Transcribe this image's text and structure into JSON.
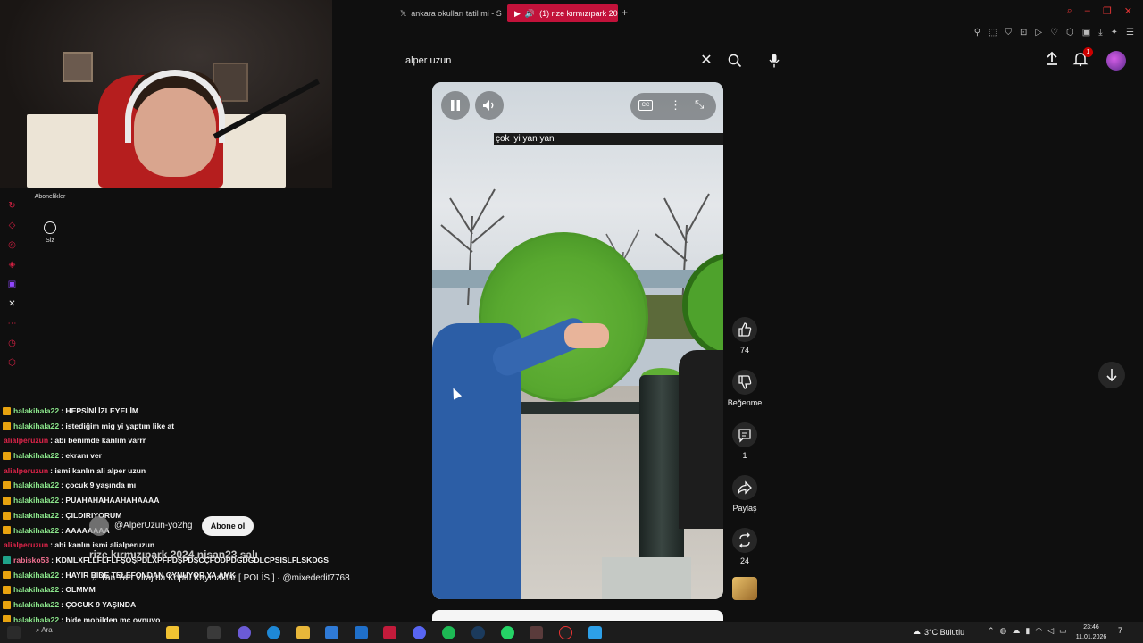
{
  "browser": {
    "tabs": [
      {
        "label": "ankara okulları tatil mi - Se",
        "favicon": "x-icon"
      },
      {
        "label": "(1) rize kırmızıpark 202",
        "favicon": "youtube-icon"
      }
    ],
    "new_tab": "+"
  },
  "youtube": {
    "search": {
      "value": "alper uzun"
    },
    "notifications_count": "1",
    "sidebar": {
      "subscriptions_label": "Abonelikler",
      "you_label": "Siz"
    },
    "short": {
      "caption": "çok iyi yan yan",
      "likes": "74",
      "dislike_label": "Beğenme",
      "comments": "1",
      "share_label": "Paylaş",
      "remix": "24",
      "channel_handle": "@AlperUzun-yo2hg",
      "subscribe_label": "Abone ol",
      "title": "rize kırmızıpark 2024 nisan23 salı",
      "music": "Yan Yan Viraj da Koptu Kaymaklar [ POLİS ] · @mixededit7768"
    }
  },
  "chat": [
    {
      "user": "halakihala22",
      "msg": ": HEPSİNİ İZLEYELİM",
      "badge": "gold",
      "color": "green"
    },
    {
      "user": "halakihala22",
      "msg": ": istediğim mig yi yaptım like at",
      "badge": "gold",
      "color": "green"
    },
    {
      "user": "alialperuzun",
      "msg": ": abi benimde kanlım varrr",
      "badge": "none",
      "color": "red"
    },
    {
      "user": "halakihala22",
      "msg": ": ekranı ver",
      "badge": "gold",
      "color": "green"
    },
    {
      "user": "alialperuzun",
      "msg": ": ismi kanlın ali alper uzun",
      "badge": "none",
      "color": "red"
    },
    {
      "user": "halakihala22",
      "msg": ": çocuk 9 yaşında mı",
      "badge": "gold",
      "color": "green"
    },
    {
      "user": "halakihala22",
      "msg": ": PUAHAHAHAAHAHAAAA",
      "badge": "gold",
      "color": "green"
    },
    {
      "user": "halakihala22",
      "msg": ": ÇILDIRIYORUM",
      "badge": "gold",
      "color": "green"
    },
    {
      "user": "halakihala22",
      "msg": ": AAAAAAAA",
      "badge": "gold",
      "color": "green"
    },
    {
      "user": "alialperuzun",
      "msg": ": abi kanlın ismi alialperuzun",
      "badge": "none",
      "color": "red"
    },
    {
      "user": "rabisko53",
      "msg": ": KDMLXFLLFLFLFŞOŞPDLXPFPDŞPDŞCÇFODPDGDGDLCPSISLFLSKDGS",
      "badge": "teal",
      "color": "pink"
    },
    {
      "user": "halakihala22",
      "msg": ": HAYIR BİDE TELEFONDAN OYNUYOR YA AMK",
      "badge": "gold",
      "color": "green"
    },
    {
      "user": "halakihala22",
      "msg": ": OLMMM",
      "badge": "gold",
      "color": "green"
    },
    {
      "user": "halakihala22",
      "msg": ": ÇOCUK 9 YAŞINDA",
      "badge": "gold",
      "color": "green"
    },
    {
      "user": "halakihala22",
      "msg": ": bide mobilden mc oynuyo",
      "badge": "gold",
      "color": "green"
    }
  ],
  "taskbar": {
    "search_label": "Ara",
    "weather": "3°C  Bulutlu",
    "time": "23:46",
    "date": "11.01.2026",
    "notif_count": "7"
  },
  "colors": {
    "accent": "#c2123a",
    "chat_green": "#8be58b",
    "chat_red": "#e0244a"
  }
}
